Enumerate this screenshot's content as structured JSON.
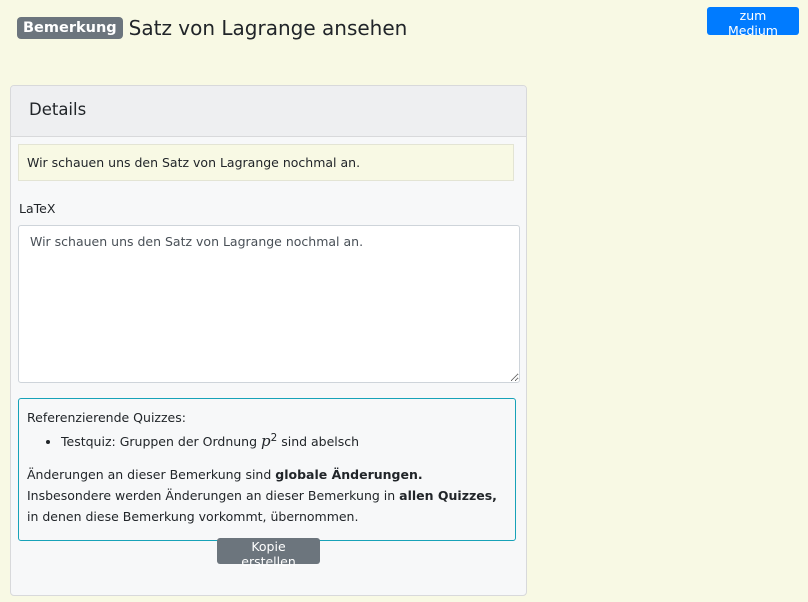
{
  "header": {
    "badge": "Bemerkung",
    "title": "Satz von Lagrange ansehen",
    "medium_button": "zum Medium"
  },
  "card": {
    "title": "Details",
    "preview": "Wir schauen uns den Satz von Lagrange nochmal an.",
    "latex_label": "LaTeX",
    "latex_value": "Wir schauen uns den Satz von Lagrange nochmal an.",
    "info": {
      "heading": "Referenzierende Quizzes:",
      "quizzes": [
        {
          "prefix": "Testquiz: Gruppen der Ordnung ",
          "math_base": "p",
          "math_exp": "2",
          "suffix": " sind abelsch"
        }
      ],
      "text1": "Änderungen an dieser Bemerkung sind ",
      "bold1": "globale Änderungen.",
      "text2": " Insbesondere werden Änderungen an dieser Bemerkung in ",
      "bold2": "allen Quizzes,",
      "text3": " in denen diese Bemerkung vorkommt, übernommen.",
      "copy_button": "Kopie erstellen"
    }
  }
}
